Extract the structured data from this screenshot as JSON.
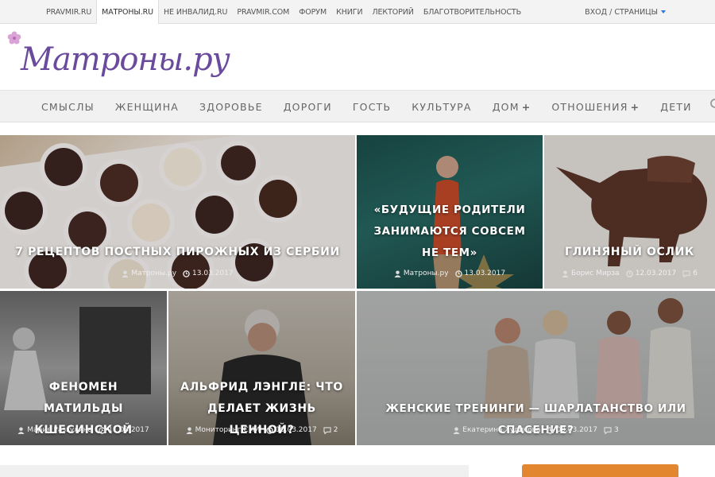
{
  "topbar": {
    "links": [
      "PRAVMIR.RU",
      "МАТРОНЫ.RU",
      "НЕ ИНВАЛИД.RU",
      "PRAVMIR.COM",
      "ФОРУМ",
      "КНИГИ",
      "ЛЕКТОРИЙ",
      "БЛАГОТВОРИТЕЛЬНОСТЬ"
    ],
    "active": "МАТРОНЫ.RU",
    "login": "ВХОД / СТРАНИЦЫ"
  },
  "logo": {
    "text": "Матроны.ру",
    "color": "#6a4a9c"
  },
  "nav": {
    "items": [
      "СМЫСЛЫ",
      "ЖЕНЩИНА",
      "ЗДОРОВЬЕ",
      "ДОРОГИ",
      "ГОСТЬ",
      "КУЛЬТУРА",
      "ДОМ",
      "ОТНОШЕНИЯ",
      "ДЕТИ"
    ],
    "items_with_plus": [
      "ДОМ",
      "ОТНОШЕНИЯ"
    ],
    "plus": "+"
  },
  "articles": [
    {
      "title": "7 РЕЦЕПТОВ ПОСТНЫХ ПИРОЖНЫХ ИЗ СЕРБИИ",
      "author": "Матроны.ру",
      "date": "13.03.2017"
    },
    {
      "title": "«БУДУЩИЕ РОДИТЕЛИ ЗАНИМАЮТСЯ СОВСЕМ НЕ ТЕМ»",
      "author": "Матроны.ру",
      "date": "13.03.2017"
    },
    {
      "title": "ГЛИНЯНЫЙ ОСЛИК",
      "author": "Борис Мирза",
      "date": "12.03.2017",
      "comments": "6"
    },
    {
      "title": "ФЕНОМЕН МАТИЛЬДЫ КШЕСИНСКОЙ",
      "author": "Мария Разгулина",
      "date": "11.03.2017"
    },
    {
      "title": "АЛЬФРИД ЛЭНГЛЕ: ЧТО ДЕЛАЕТ ЖИЗНЬ ЦЕННОЙ?",
      "author": "Мониторинг СМИ",
      "date": "10.03.2017",
      "comments": "2"
    },
    {
      "title": "ЖЕНСКИЕ ТРЕНИНГИ — ШАРЛАТАНСТВО ИЛИ СПАСЕНИЕ?",
      "author": "Екатерина Худякова",
      "date": "09.03.2017",
      "comments": "3"
    }
  ],
  "colors": {
    "accent": "#6a4a9c",
    "button": "#e2862f",
    "link_blue": "#2a7ad6"
  },
  "icons": [
    "flower-icon",
    "search-icon",
    "user-icon",
    "clock-icon",
    "comment-icon",
    "caret-down-icon"
  ]
}
